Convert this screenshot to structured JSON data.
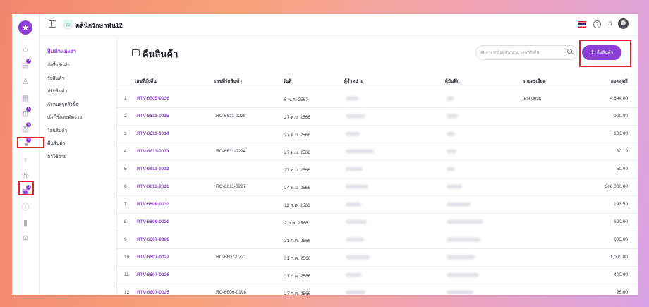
{
  "header": {
    "clinic_name": "คลินิกรักษาฟัน12"
  },
  "rail": {
    "logo": "★",
    "icons": [
      {
        "name": "home-icon",
        "glyph": "⌂",
        "badge": ""
      },
      {
        "name": "calendar-icon",
        "glyph": "▤",
        "badge": "0"
      },
      {
        "name": "patient-icon",
        "glyph": "♙",
        "badge": ""
      },
      {
        "name": "record-icon",
        "glyph": "▦",
        "badge": ""
      },
      {
        "name": "clinic-icon",
        "glyph": "▥",
        "badge": "1"
      },
      {
        "name": "finance-icon",
        "glyph": "▧",
        "badge": "2"
      },
      {
        "name": "hand-icon",
        "glyph": "☚",
        "badge": "5"
      },
      {
        "name": "tooth-icon",
        "glyph": "♆",
        "badge": ""
      },
      {
        "name": "percent-icon",
        "glyph": "%",
        "badge": ""
      },
      {
        "name": "inventory-icon",
        "glyph": "▣",
        "badge": "0"
      },
      {
        "name": "info-icon",
        "glyph": "ⓘ",
        "badge": ""
      },
      {
        "name": "report-icon",
        "glyph": "▮",
        "badge": ""
      },
      {
        "name": "settings-icon",
        "glyph": "⚙",
        "badge": ""
      }
    ]
  },
  "submenu": {
    "title": "สินค้าและยา",
    "items": [
      "สั่งซื้อสินค้า",
      "รับสินค้า",
      "ปรับสินค้า",
      "กำหนดจุดสั่งซื้อ",
      "เบิกใช้และตัดจ่าย",
      "โอนสินค้า",
      "คืนสินค้า",
      "ค่าใช้จ่าย"
    ]
  },
  "page": {
    "title": "คืนสินค้า",
    "search_placeholder": "ค้นหาจากชื่อผู้จำหน่าย, เลขที่สั่งคืน",
    "add_label": "คืนสินค้า"
  },
  "table": {
    "columns": [
      "เลขที่สั่งคืน",
      "เลขที่รับสินค้า",
      "วันที่",
      "ผู้จำหน่าย",
      "ผู้บันทึก",
      "รายละเอียด",
      "ยอดสุทธิ"
    ],
    "rows": [
      {
        "no": "1",
        "code": "RTV-6705-0036",
        "receive": "",
        "date": "6 พ.ค. 2567",
        "detail": "test desc",
        "total": "4,844.00"
      },
      {
        "no": "2",
        "code": "RTV-6611-0035",
        "receive": "RO-6611-0228",
        "date": "27 พ.ย. 2566",
        "detail": "",
        "total": "900.00"
      },
      {
        "no": "3",
        "code": "RTV-6611-0034",
        "receive": "",
        "date": "27 พ.ย. 2566",
        "detail": "",
        "total": "100.00"
      },
      {
        "no": "4",
        "code": "RTV-6611-0033",
        "receive": "RO-6611-0224",
        "date": "27 พ.ย. 2566",
        "detail": "",
        "total": "60.19"
      },
      {
        "no": "5",
        "code": "RTV-6611-0032",
        "receive": "",
        "date": "27 พ.ย. 2566",
        "detail": "",
        "total": "50.00"
      },
      {
        "no": "6",
        "code": "RTV-6611-0031",
        "receive": "RO-6611-0227",
        "date": "24 พ.ย. 2566",
        "detail": "",
        "total": "360,000.00"
      },
      {
        "no": "7",
        "code": "RTV-6608-0030",
        "receive": "",
        "date": "11 ส.ค. 2566",
        "detail": "",
        "total": "193.50"
      },
      {
        "no": "8",
        "code": "RTV-6608-0029",
        "receive": "",
        "date": "2 ส.ค. 2566",
        "detail": "",
        "total": "600.00"
      },
      {
        "no": "9",
        "code": "RTV-6607-0028",
        "receive": "",
        "date": "31 ก.ค. 2566",
        "detail": "",
        "total": "600.00"
      },
      {
        "no": "10",
        "code": "RTV-6607-0027",
        "receive": "RO-6607-0221",
        "date": "31 ก.ค. 2566",
        "detail": "",
        "total": "1,000.00"
      },
      {
        "no": "11",
        "code": "RTV-6607-0026",
        "receive": "",
        "date": "31 ก.ค. 2566",
        "detail": "",
        "total": "400.00"
      },
      {
        "no": "12",
        "code": "RTV-6607-0025",
        "receive": "RO-6606-0198",
        "date": "27 ก.ค. 2566",
        "detail": "",
        "total": "96.00"
      }
    ]
  },
  "colors": {
    "accent": "#8b3fd6",
    "highlight": "#e0202a"
  }
}
